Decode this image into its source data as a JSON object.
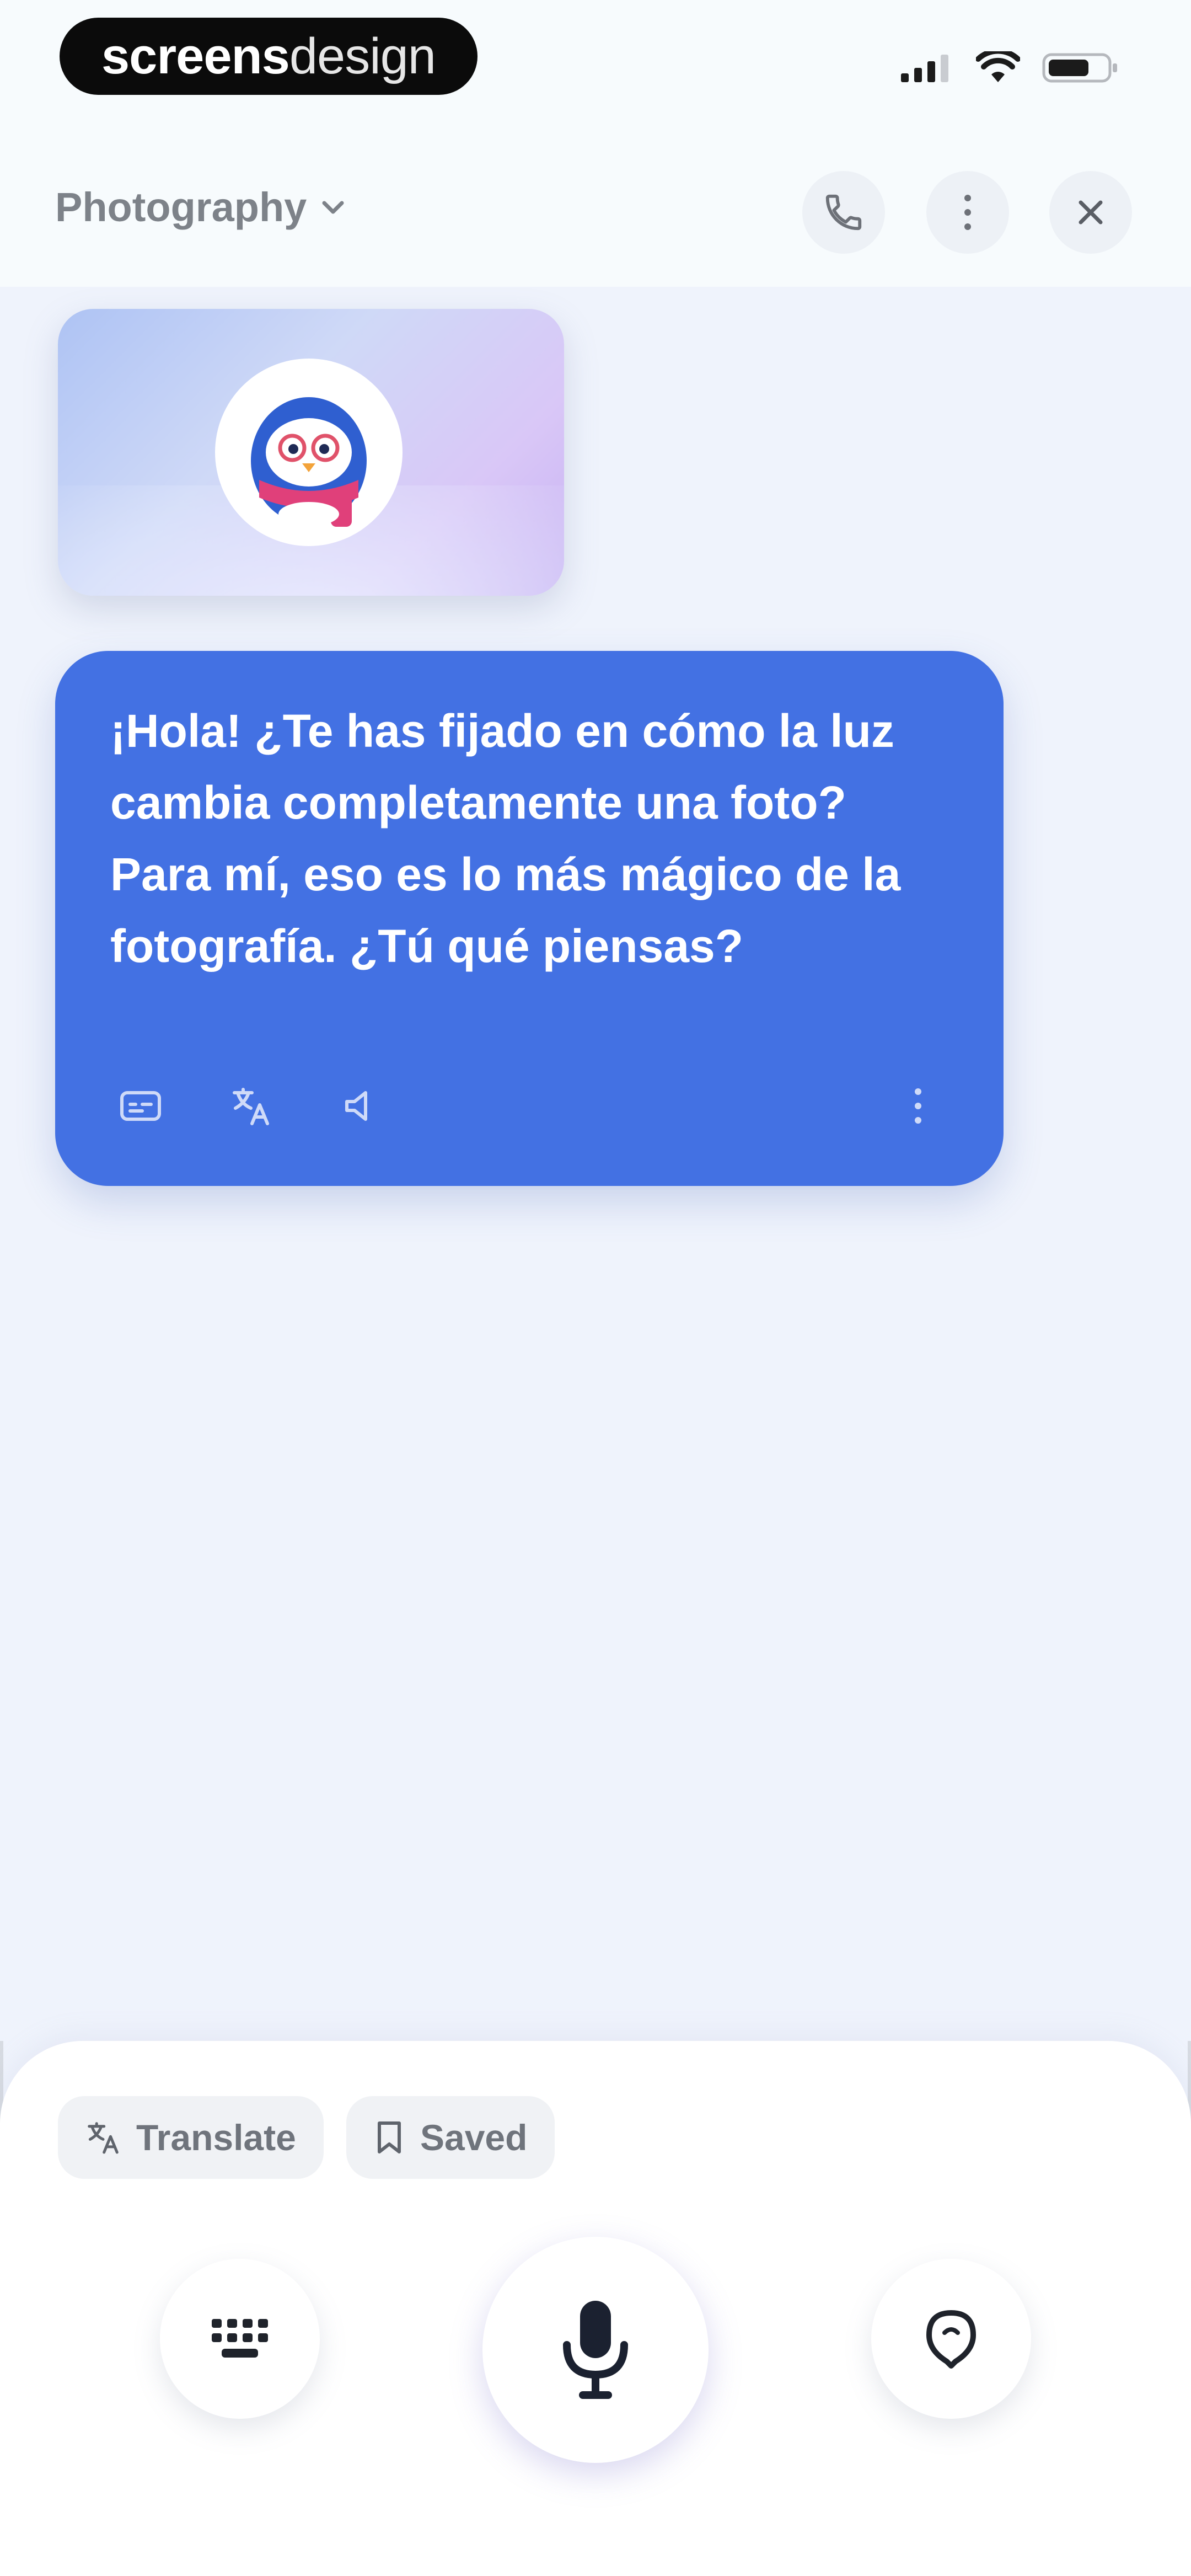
{
  "status_bar": {
    "brand_bold": "screens",
    "brand_light": "design",
    "icons": [
      "signal-icon",
      "wifi-icon",
      "battery-icon"
    ]
  },
  "header": {
    "topic": "Photography",
    "icons": [
      "chevron-down-icon",
      "phone-icon",
      "more-vertical-icon",
      "close-icon"
    ]
  },
  "chat": {
    "avatar": "penguin-mascot",
    "message": "¡Hola! ¿Te has fijado en cómo la luz cambia completamente una foto? Para mí, eso es lo más mágico de la fotografía. ¿Tú qué piensas?",
    "message_tools": [
      "subtitles-icon",
      "translate-icon",
      "speaker-icon",
      "more-vertical-icon"
    ]
  },
  "bottom": {
    "translate_label": "Translate",
    "saved_label": "Saved",
    "buttons": [
      "keyboard-icon",
      "microphone-icon",
      "hint-icon"
    ]
  },
  "colors": {
    "accent": "#4371e3",
    "background": "#eff3fc",
    "header_bg": "#f7fbfd"
  }
}
